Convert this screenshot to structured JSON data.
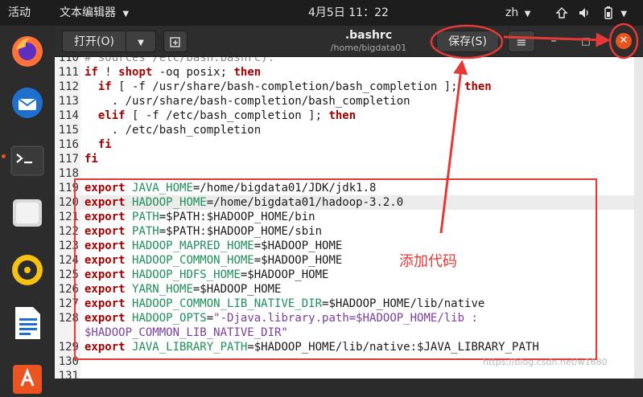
{
  "topbar": {
    "activities": "活动",
    "app_menu": "文本编辑器",
    "clock": "4月5日  11：22",
    "lang": "zh"
  },
  "toolbar": {
    "open_label": "打开(O)",
    "save_label": "保存(S)",
    "title": ".bashrc",
    "subtitle": "/home/bigdata01"
  },
  "editor": {
    "lines": [
      {
        "n": "110",
        "t": "# sources /etc/bash.bashrc)."
      },
      {
        "n": "111",
        "t": "if ! shopt -oq posix; then"
      },
      {
        "n": "112",
        "t": "  if [ -f /usr/share/bash-completion/bash_completion ]; then"
      },
      {
        "n": "113",
        "t": "    . /usr/share/bash-completion/bash_completion"
      },
      {
        "n": "114",
        "t": "  elif [ -f /etc/bash_completion ]; then"
      },
      {
        "n": "115",
        "t": "    . /etc/bash_completion"
      },
      {
        "n": "116",
        "t": "  fi"
      },
      {
        "n": "117",
        "t": "fi"
      },
      {
        "n": "118",
        "t": ""
      },
      {
        "n": "119",
        "t": "export JAVA_HOME=/home/bigdata01/JDK/jdk1.8"
      },
      {
        "n": "120",
        "t": "export HADOOP_HOME=/home/bigdata01/hadoop-3.2.0"
      },
      {
        "n": "121",
        "t": "export PATH=$PATH:$HADOOP_HOME/bin"
      },
      {
        "n": "122",
        "t": "export PATH=$PATH:$HADOOP_HOME/sbin"
      },
      {
        "n": "123",
        "t": "export HADOOP_MAPRED_HOME=$HADOOP_HOME"
      },
      {
        "n": "124",
        "t": "export HADOOP_COMMON_HOME=$HADOOP_HOME"
      },
      {
        "n": "125",
        "t": "export HADOOP_HDFS_HOME=$HADOOP_HOME"
      },
      {
        "n": "126",
        "t": "export YARN_HOME=$HADOOP_HOME"
      },
      {
        "n": "127",
        "t": "export HADOOP_COMMON_LIB_NATIVE_DIR=$HADOOP_HOME/lib/native"
      },
      {
        "n": "128",
        "t": "export HADOOP_OPTS=\"-Djava.library.path=$HADOOP_HOME/lib :"
      },
      {
        "n": "",
        "t": "$HADOOP_COMMON_LIB_NATIVE_DIR\""
      },
      {
        "n": "129",
        "t": "export JAVA_LIBRARY_PATH=$HADOOP_HOME/lib/native:$JAVA_LIBRARY_PATH"
      },
      {
        "n": "130",
        "t": ""
      },
      {
        "n": "131",
        "t": ""
      }
    ],
    "current_line": "120"
  },
  "annotation": {
    "label": "添加代码",
    "color": "#e53935"
  },
  "watermark": "https://blog.csdn.net/w1680",
  "colors": {
    "keyword": "#a50000",
    "variable": "#1e8e5a",
    "string": "#7a3e9d",
    "accent": "#e95420"
  }
}
